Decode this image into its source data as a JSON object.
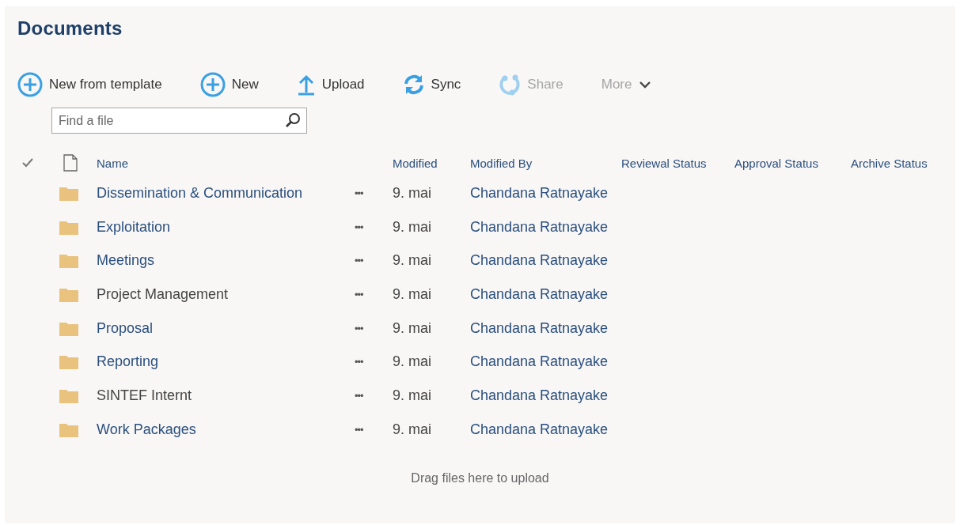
{
  "title": "Documents",
  "commands": [
    {
      "kind": "add",
      "label": "New from template",
      "disabled": false
    },
    {
      "kind": "add",
      "label": "New",
      "disabled": false
    },
    {
      "kind": "upload",
      "label": "Upload",
      "disabled": false
    },
    {
      "kind": "sync",
      "label": "Sync",
      "disabled": false
    },
    {
      "kind": "share",
      "label": "Share",
      "disabled": true
    },
    {
      "kind": "more",
      "label": "More",
      "disabled": true
    }
  ],
  "search": {
    "placeholder": "Find a file"
  },
  "table": {
    "columns": [
      "Name",
      "Modified",
      "Modified By",
      "Reviewal Status",
      "Approval Status",
      "Archive Status"
    ],
    "rows": [
      {
        "name": "Dissemination & Communication",
        "modified": "9. mai",
        "modified_by": "Chandana Ratnayake",
        "color": "#2b4f7e"
      },
      {
        "name": "Exploitation",
        "modified": "9. mai",
        "modified_by": "Chandana Ratnayake",
        "color": "#2b4f7e"
      },
      {
        "name": "Meetings",
        "modified": "9. mai",
        "modified_by": "Chandana Ratnayake",
        "color": "#2b4f7e"
      },
      {
        "name": "Project Management",
        "modified": "9. mai",
        "modified_by": "Chandana Ratnayake",
        "color": "#444444"
      },
      {
        "name": "Proposal",
        "modified": "9. mai",
        "modified_by": "Chandana Ratnayake",
        "color": "#2b4f7e"
      },
      {
        "name": "Reporting",
        "modified": "9. mai",
        "modified_by": "Chandana Ratnayake",
        "color": "#2b4f7e"
      },
      {
        "name": "SINTEF Internt",
        "modified": "9. mai",
        "modified_by": "Chandana Ratnayake",
        "color": "#444444"
      },
      {
        "name": "Work Packages",
        "modified": "9. mai",
        "modified_by": "Chandana Ratnayake",
        "color": "#2b4f7e"
      }
    ],
    "row_menu": "•••"
  },
  "drop_hint": "Drag files here to upload"
}
